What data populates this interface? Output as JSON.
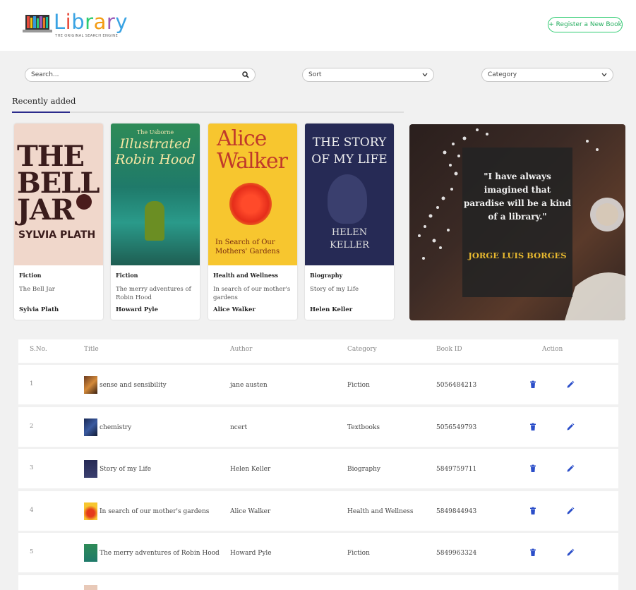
{
  "header": {
    "logo_word": "Library",
    "logo_tagline": "THE ORIGINAL SEARCH ENGINE",
    "register_label": "+ Register a New Book"
  },
  "controls": {
    "search_placeholder": "Search...",
    "sort_value": "Sort",
    "category_value": "Category"
  },
  "recent": {
    "tab_label": "Recently added",
    "books": [
      {
        "category": "Fiction",
        "title": "The Bell Jar",
        "author": "Sylvia Plath",
        "cover_line1": "THE",
        "cover_line2": "BELL",
        "cover_line3": "JAR",
        "cover_author": "SYLVIA PLATH"
      },
      {
        "category": "Fiction",
        "title": "The merry adventures of Robin Hood",
        "author": "Howard Pyle",
        "cover_line1": "The Usborne",
        "cover_line2": "Illustrated",
        "cover_line3": "Robin Hood"
      },
      {
        "category": "Health and Wellness",
        "title": "In search of our mother's gardens",
        "author": "Alice Walker",
        "cover_line1": "Alice",
        "cover_line2": "Walker",
        "cover_line3": "In Search of Our Mothers' Gardens"
      },
      {
        "category": "Biography",
        "title": "Story of my Life",
        "author": "Helen Keller",
        "cover_line1": "THE STORY",
        "cover_line2": "OF MY LIFE",
        "cover_line3": "HELEN KELLER"
      }
    ]
  },
  "quote": {
    "text": "\"I have always imagined that paradise will be a kind of a library.\"",
    "author": "JORGE LUIS BORGES"
  },
  "table": {
    "headers": [
      "S.No.",
      "Title",
      "Author",
      "Category",
      "Book ID",
      "Action"
    ],
    "rows": [
      {
        "sno": "1",
        "title": "sense and sensibility",
        "author": "jane austen",
        "category": "Fiction",
        "book_id": "5056484213"
      },
      {
        "sno": "2",
        "title": "chemistry",
        "author": "ncert",
        "category": "Textbooks",
        "book_id": "5056549793"
      },
      {
        "sno": "3",
        "title": "Story of my Life",
        "author": "Helen Keller",
        "category": "Biography",
        "book_id": "5849759711"
      },
      {
        "sno": "4",
        "title": "In search of our mother's gardens",
        "author": "Alice Walker",
        "category": "Health and Wellness",
        "book_id": "5849844943"
      },
      {
        "sno": "5",
        "title": "The merry adventures of Robin Hood",
        "author": "Howard Pyle",
        "category": "Fiction",
        "book_id": "5849963324"
      }
    ]
  },
  "icons": {
    "search": "search-icon",
    "delete": "trash-icon",
    "edit": "pencil-icon",
    "chevron": "chevron-down-icon"
  },
  "colors": {
    "accent": "#2b2b8c",
    "register": "#27ae60",
    "action_icon": "#2b4ec9",
    "quote_author": "#e8b92f"
  }
}
